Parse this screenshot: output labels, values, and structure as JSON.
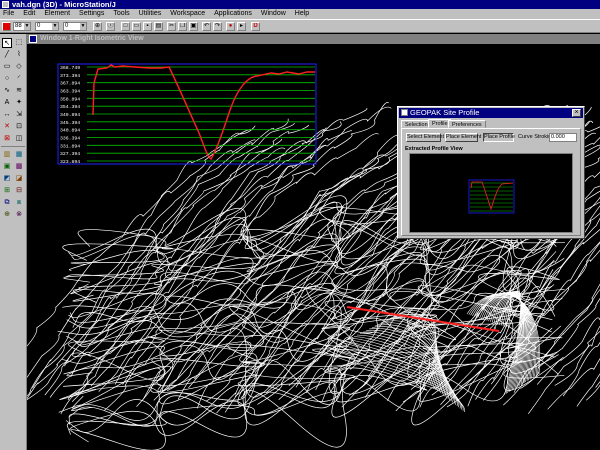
{
  "app": {
    "title": "vah.dgn (3D) - MicroStation/J",
    "menu": [
      "File",
      "Edit",
      "Element",
      "Settings",
      "Tools",
      "Utilities",
      "Workspace",
      "Applications",
      "Window",
      "Help"
    ]
  },
  "toolbar": {
    "color_value": "88",
    "weight_value": "0",
    "style_value": "0"
  },
  "view": {
    "title": "Window 1-Right Isometric View"
  },
  "inset_profile": {
    "y_labels": [
      "368.749",
      "373.394",
      "367.894",
      "363.394",
      "358.894",
      "354.394",
      "349.894",
      "345.394",
      "340.894",
      "336.394",
      "331.894",
      "327.394",
      "323.894"
    ],
    "colors": {
      "profile": "#ff2020",
      "grid": "#00c000",
      "frame": "#2020ff"
    }
  },
  "dialog": {
    "title": "GEOPAK Site Profile",
    "tabs": [
      "Selection",
      "Profile",
      "Preferences"
    ],
    "active_tab": "Profile",
    "buttons": {
      "select_element": "Select Element",
      "place_element": "Place Element",
      "place_profile": "Place Profile"
    },
    "curve_stroking_label": "Curve Stroking",
    "curve_stroking_value": "0.000",
    "group_label": "Extracted Profile View"
  },
  "road_alignment": {
    "color": "#ff2020"
  },
  "terrain": {
    "color": "#ffffff"
  }
}
